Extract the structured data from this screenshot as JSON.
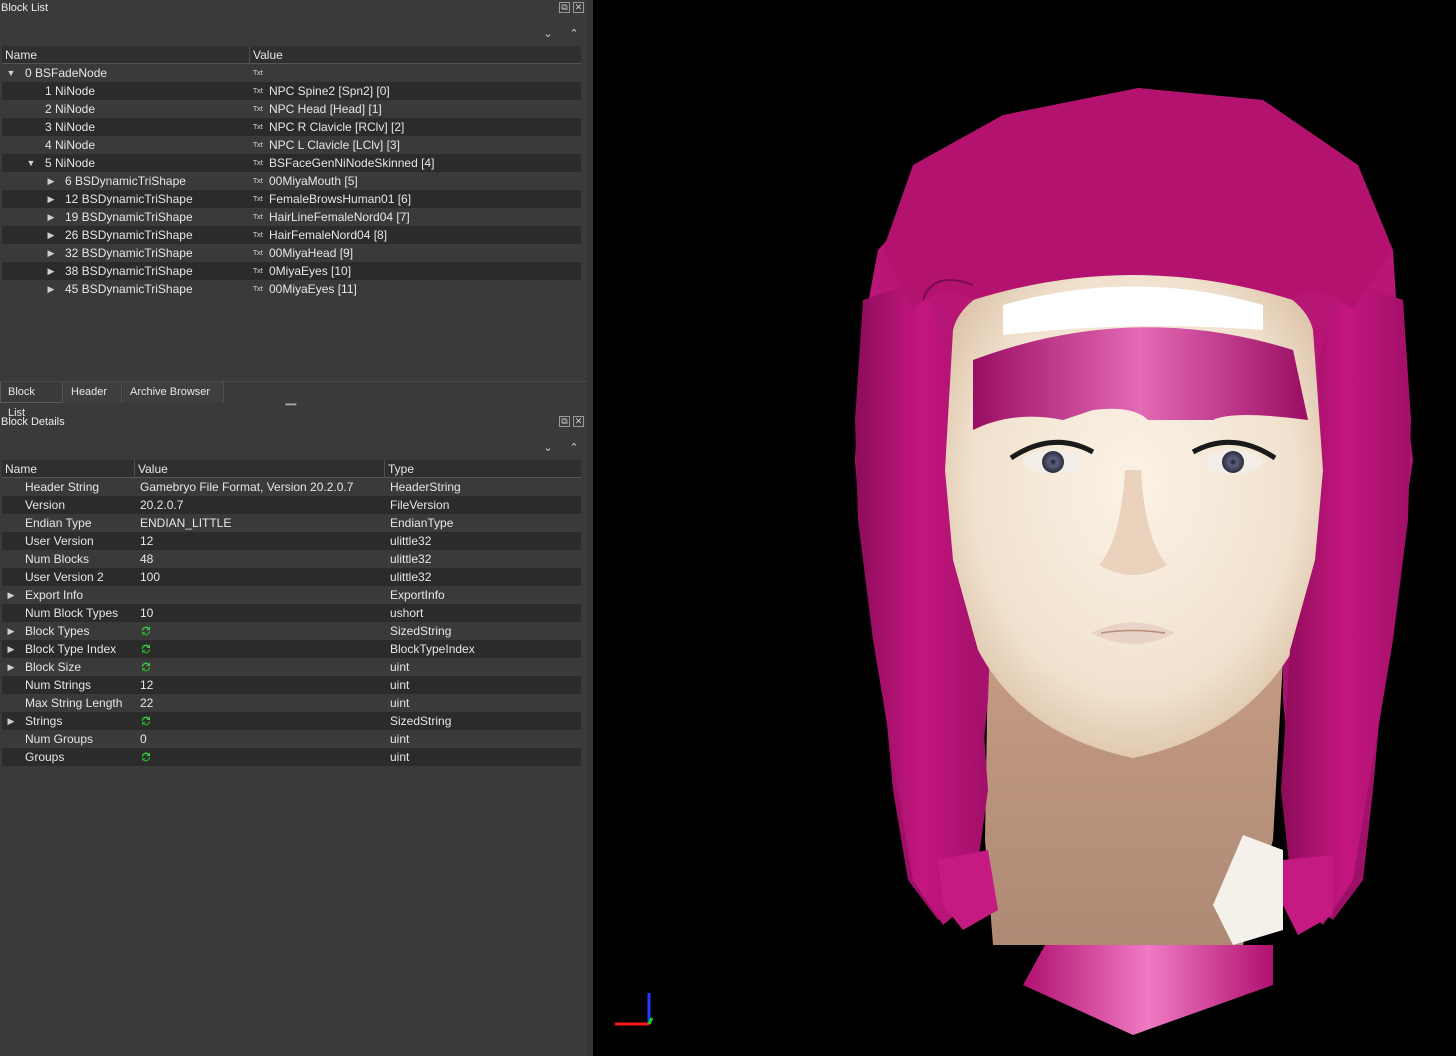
{
  "block_list": {
    "title": "Block List",
    "columns": [
      "Name",
      "Value"
    ],
    "rows": [
      {
        "name": "0 BSFadeNode",
        "value": "",
        "indent": 0,
        "arrow": "down"
      },
      {
        "name": "1 NiNode",
        "value": "NPC Spine2 [Spn2] [0]",
        "indent": 1,
        "arrow": ""
      },
      {
        "name": "2 NiNode",
        "value": "NPC Head [Head] [1]",
        "indent": 1,
        "arrow": ""
      },
      {
        "name": "3 NiNode",
        "value": "NPC R Clavicle [RClv] [2]",
        "indent": 1,
        "arrow": ""
      },
      {
        "name": "4 NiNode",
        "value": "NPC L Clavicle [LClv] [3]",
        "indent": 1,
        "arrow": ""
      },
      {
        "name": "5 NiNode",
        "value": "BSFaceGenNiNodeSkinned [4]",
        "indent": 1,
        "arrow": "down"
      },
      {
        "name": "6 BSDynamicTriShape",
        "value": "00MiyaMouth [5]",
        "indent": 2,
        "arrow": "right"
      },
      {
        "name": "12 BSDynamicTriShape",
        "value": "FemaleBrowsHuman01 [6]",
        "indent": 2,
        "arrow": "right"
      },
      {
        "name": "19 BSDynamicTriShape",
        "value": "HairLineFemaleNord04 [7]",
        "indent": 2,
        "arrow": "right"
      },
      {
        "name": "26 BSDynamicTriShape",
        "value": "HairFemaleNord04 [8]",
        "indent": 2,
        "arrow": "right"
      },
      {
        "name": "32 BSDynamicTriShape",
        "value": "00MiyaHead [9]",
        "indent": 2,
        "arrow": "right"
      },
      {
        "name": "38 BSDynamicTriShape",
        "value": "0MiyaEyes [10]",
        "indent": 2,
        "arrow": "right"
      },
      {
        "name": "45 BSDynamicTriShape",
        "value": "00MiyaEyes [11]",
        "indent": 2,
        "arrow": "right"
      }
    ]
  },
  "tabs": [
    "Block List",
    "Header",
    "Archive Browser"
  ],
  "block_details": {
    "title": "Block Details",
    "columns": [
      "Name",
      "Value",
      "Type"
    ],
    "rows": [
      {
        "name": "Header String",
        "value": "Gamebryo File Format, Version 20.2.0.7",
        "type": "HeaderString",
        "expand": false,
        "ref": false
      },
      {
        "name": "Version",
        "value": "20.2.0.7",
        "type": "FileVersion",
        "expand": false,
        "ref": false
      },
      {
        "name": "Endian Type",
        "value": "ENDIAN_LITTLE",
        "type": "EndianType",
        "expand": false,
        "ref": false
      },
      {
        "name": "User Version",
        "value": "12",
        "type": "ulittle32",
        "expand": false,
        "ref": false
      },
      {
        "name": "Num Blocks",
        "value": "48",
        "type": "ulittle32",
        "expand": false,
        "ref": false
      },
      {
        "name": "User Version 2",
        "value": "100",
        "type": "ulittle32",
        "expand": false,
        "ref": false
      },
      {
        "name": "Export Info",
        "value": "",
        "type": "ExportInfo",
        "expand": true,
        "ref": false
      },
      {
        "name": "Num Block Types",
        "value": "10",
        "type": "ushort",
        "expand": false,
        "ref": false
      },
      {
        "name": "Block Types",
        "value": "",
        "type": "SizedString",
        "expand": true,
        "ref": true
      },
      {
        "name": "Block Type Index",
        "value": "",
        "type": "BlockTypeIndex",
        "expand": true,
        "ref": true
      },
      {
        "name": "Block Size",
        "value": "",
        "type": "uint",
        "expand": true,
        "ref": true
      },
      {
        "name": "Num Strings",
        "value": "12",
        "type": "uint",
        "expand": false,
        "ref": false
      },
      {
        "name": "Max String Length",
        "value": "22",
        "type": "uint",
        "expand": false,
        "ref": false
      },
      {
        "name": "Strings",
        "value": "",
        "type": "SizedString",
        "expand": true,
        "ref": true
      },
      {
        "name": "Num Groups",
        "value": "0",
        "type": "uint",
        "expand": false,
        "ref": false
      },
      {
        "name": "Groups",
        "value": "",
        "type": "uint",
        "expand": false,
        "ref": true
      }
    ]
  },
  "icons": {
    "txt_label": "Txt",
    "float": "⧉",
    "close": "✕",
    "collapse": "⌄",
    "expand": "⌃"
  },
  "colors": {
    "hair": "#c0147a",
    "skin": "#f4e6d8",
    "panel": "#3a3a3a"
  }
}
